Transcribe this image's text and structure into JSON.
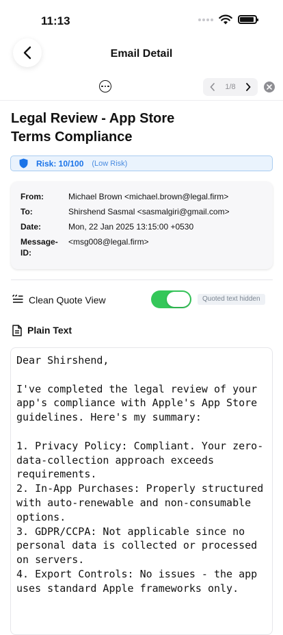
{
  "status": {
    "time": "11:13"
  },
  "nav": {
    "title": "Email Detail"
  },
  "pager": {
    "label": "1/8"
  },
  "email": {
    "subject": "Legal Review - App Store Terms Compliance",
    "risk": {
      "label": "Risk: 10/100",
      "level": "(Low Risk)",
      "score": 10,
      "color": "#1a73e8"
    },
    "headers": {
      "from_label": "From:",
      "from": "Michael Brown <michael.brown@legal.firm>",
      "to_label": "To:",
      "to": "Shirshend Sasmal <sasmalgiri@gmail.com>",
      "date_label": "Date:",
      "date": "Mon, 22 Jan 2025 13:15:00 +0530",
      "msgid_label": "Message-ID:",
      "msgid": "<msg008@legal.firm>"
    },
    "quote_view": {
      "label": "Clean Quote View",
      "enabled": true,
      "hint": "Quoted text hidden"
    },
    "plain_text_label": "Plain Text",
    "body": "Dear Shirshend,\n\nI've completed the legal review of your app's compliance with Apple's App Store guidelines. Here's my summary:\n\n1. Privacy Policy: Compliant. Your zero-data-collection approach exceeds requirements.\n2. In-App Purchases: Properly structured with auto-renewable and non-consumable options.\n3. GDPR/CCPA: Not applicable since no personal data is collected or processed on servers.\n4. Export Controls: No issues - the app uses standard Apple frameworks only."
  },
  "colors": {
    "toggle_on": "#34c759",
    "risk_bg": "#eaf3fd"
  }
}
